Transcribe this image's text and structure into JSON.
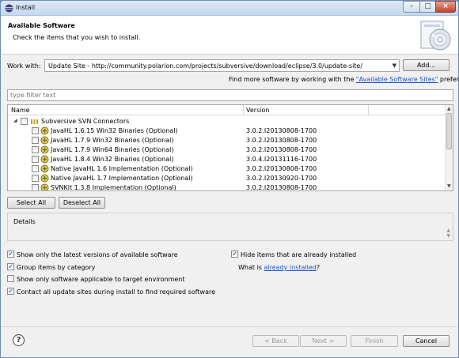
{
  "window": {
    "title": "Install"
  },
  "header": {
    "title": "Available Software",
    "description": "Check the items that you wish to install."
  },
  "work_with": {
    "label": "Work with:",
    "value": "Update Site - http://community.polarion.com/projects/subversive/download/eclipse/3.0/update-site/",
    "add_button": "Add...",
    "hint_prefix": "Find more software by working with the ",
    "hint_link": "\"Available Software Sites\"",
    "hint_suffix": " preferences."
  },
  "filter": {
    "placeholder": "type filter text"
  },
  "table": {
    "columns": {
      "name": "Name",
      "version": "Version"
    },
    "group": {
      "name": "Subversive SVN Connectors"
    },
    "rows": [
      {
        "name": "JavaHL 1.6.15 Win32 Binaries (Optional)",
        "version": "3.0.2.I20130808-1700"
      },
      {
        "name": "JavaHL 1.7.9 Win32 Binaries (Optional)",
        "version": "3.0.2.I20130808-1700"
      },
      {
        "name": "JavaHL 1.7.9 Win64 Binaries (Optional)",
        "version": "3.0.2.I20130808-1700"
      },
      {
        "name": "JavaHL 1.8.4 Win32 Binaries (Optional)",
        "version": "3.0.4.I20131116-1700"
      },
      {
        "name": "Native JavaHL 1.6 Implementation (Optional)",
        "version": "3.0.2.I20130808-1700"
      },
      {
        "name": "Native JavaHL 1.7 Implementation (Optional)",
        "version": "3.0.2.I20130920-1700"
      },
      {
        "name": "SVNKit 1.3.8 Implementation (Optional)",
        "version": "3.0.2.I20130808-1700"
      }
    ]
  },
  "selection_buttons": {
    "select_all": "Select All",
    "deselect_all": "Deselect All"
  },
  "details": {
    "label": "Details"
  },
  "options": {
    "latest_versions": {
      "label": "Show only the latest versions of available software",
      "checked": true
    },
    "group_by_category": {
      "label": "Group items by category",
      "checked": true
    },
    "target_env": {
      "label": "Show only software applicable to target environment",
      "checked": false
    },
    "contact_sites": {
      "label": "Contact all update sites during install to find required software",
      "checked": true
    },
    "hide_installed": {
      "label": "Hide items that are already installed",
      "checked": true
    },
    "what_is_prefix": "What is ",
    "already_installed_link": "already installed",
    "what_is_suffix": "?"
  },
  "footer": {
    "help": "?",
    "back": "< Back",
    "next": "Next >",
    "finish": "Finish",
    "cancel": "Cancel"
  },
  "colors": {
    "link": "#1a55c8",
    "window_border": "#6d8db0"
  }
}
